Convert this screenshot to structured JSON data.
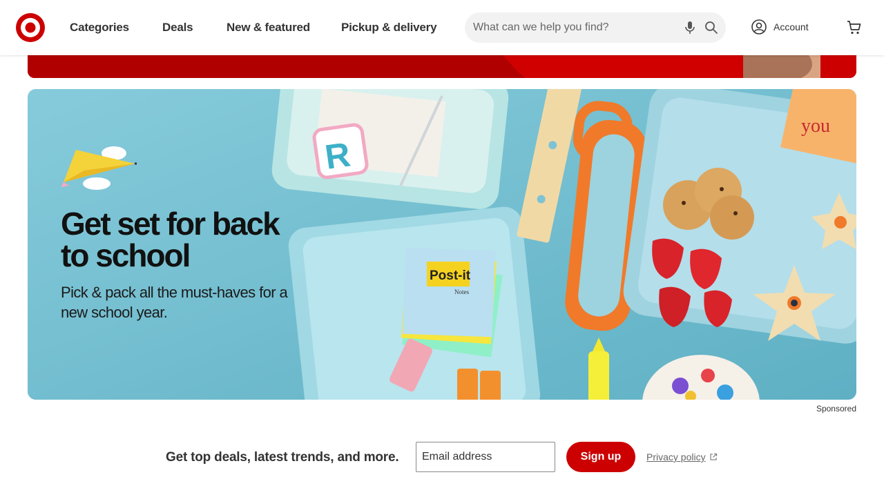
{
  "header": {
    "nav": [
      {
        "label": "Categories"
      },
      {
        "label": "Deals"
      },
      {
        "label": "New & featured"
      },
      {
        "label": "Pickup & delivery"
      }
    ],
    "search": {
      "placeholder": "What can we help you find?"
    },
    "account_label": "Account",
    "icons": [
      "target-logo-icon",
      "microphone-icon",
      "search-icon",
      "account-icon",
      "cart-icon"
    ]
  },
  "hero": {
    "title": "Get set for back to school",
    "subtitle": "Pick & pack all the must-haves for a new school year.",
    "sponsored_label": "Sponsored",
    "note_text": "you",
    "sticky_brand": "Post-it",
    "sticky_sub": "Notes",
    "patch_letter": "R"
  },
  "newsletter": {
    "label": "Get top deals, latest trends, and more.",
    "email_placeholder": "Email address",
    "signup_label": "Sign up",
    "privacy_label": "Privacy policy"
  },
  "colors": {
    "brand_red": "#cc0000",
    "hero_bg": "#7ec3d3"
  }
}
